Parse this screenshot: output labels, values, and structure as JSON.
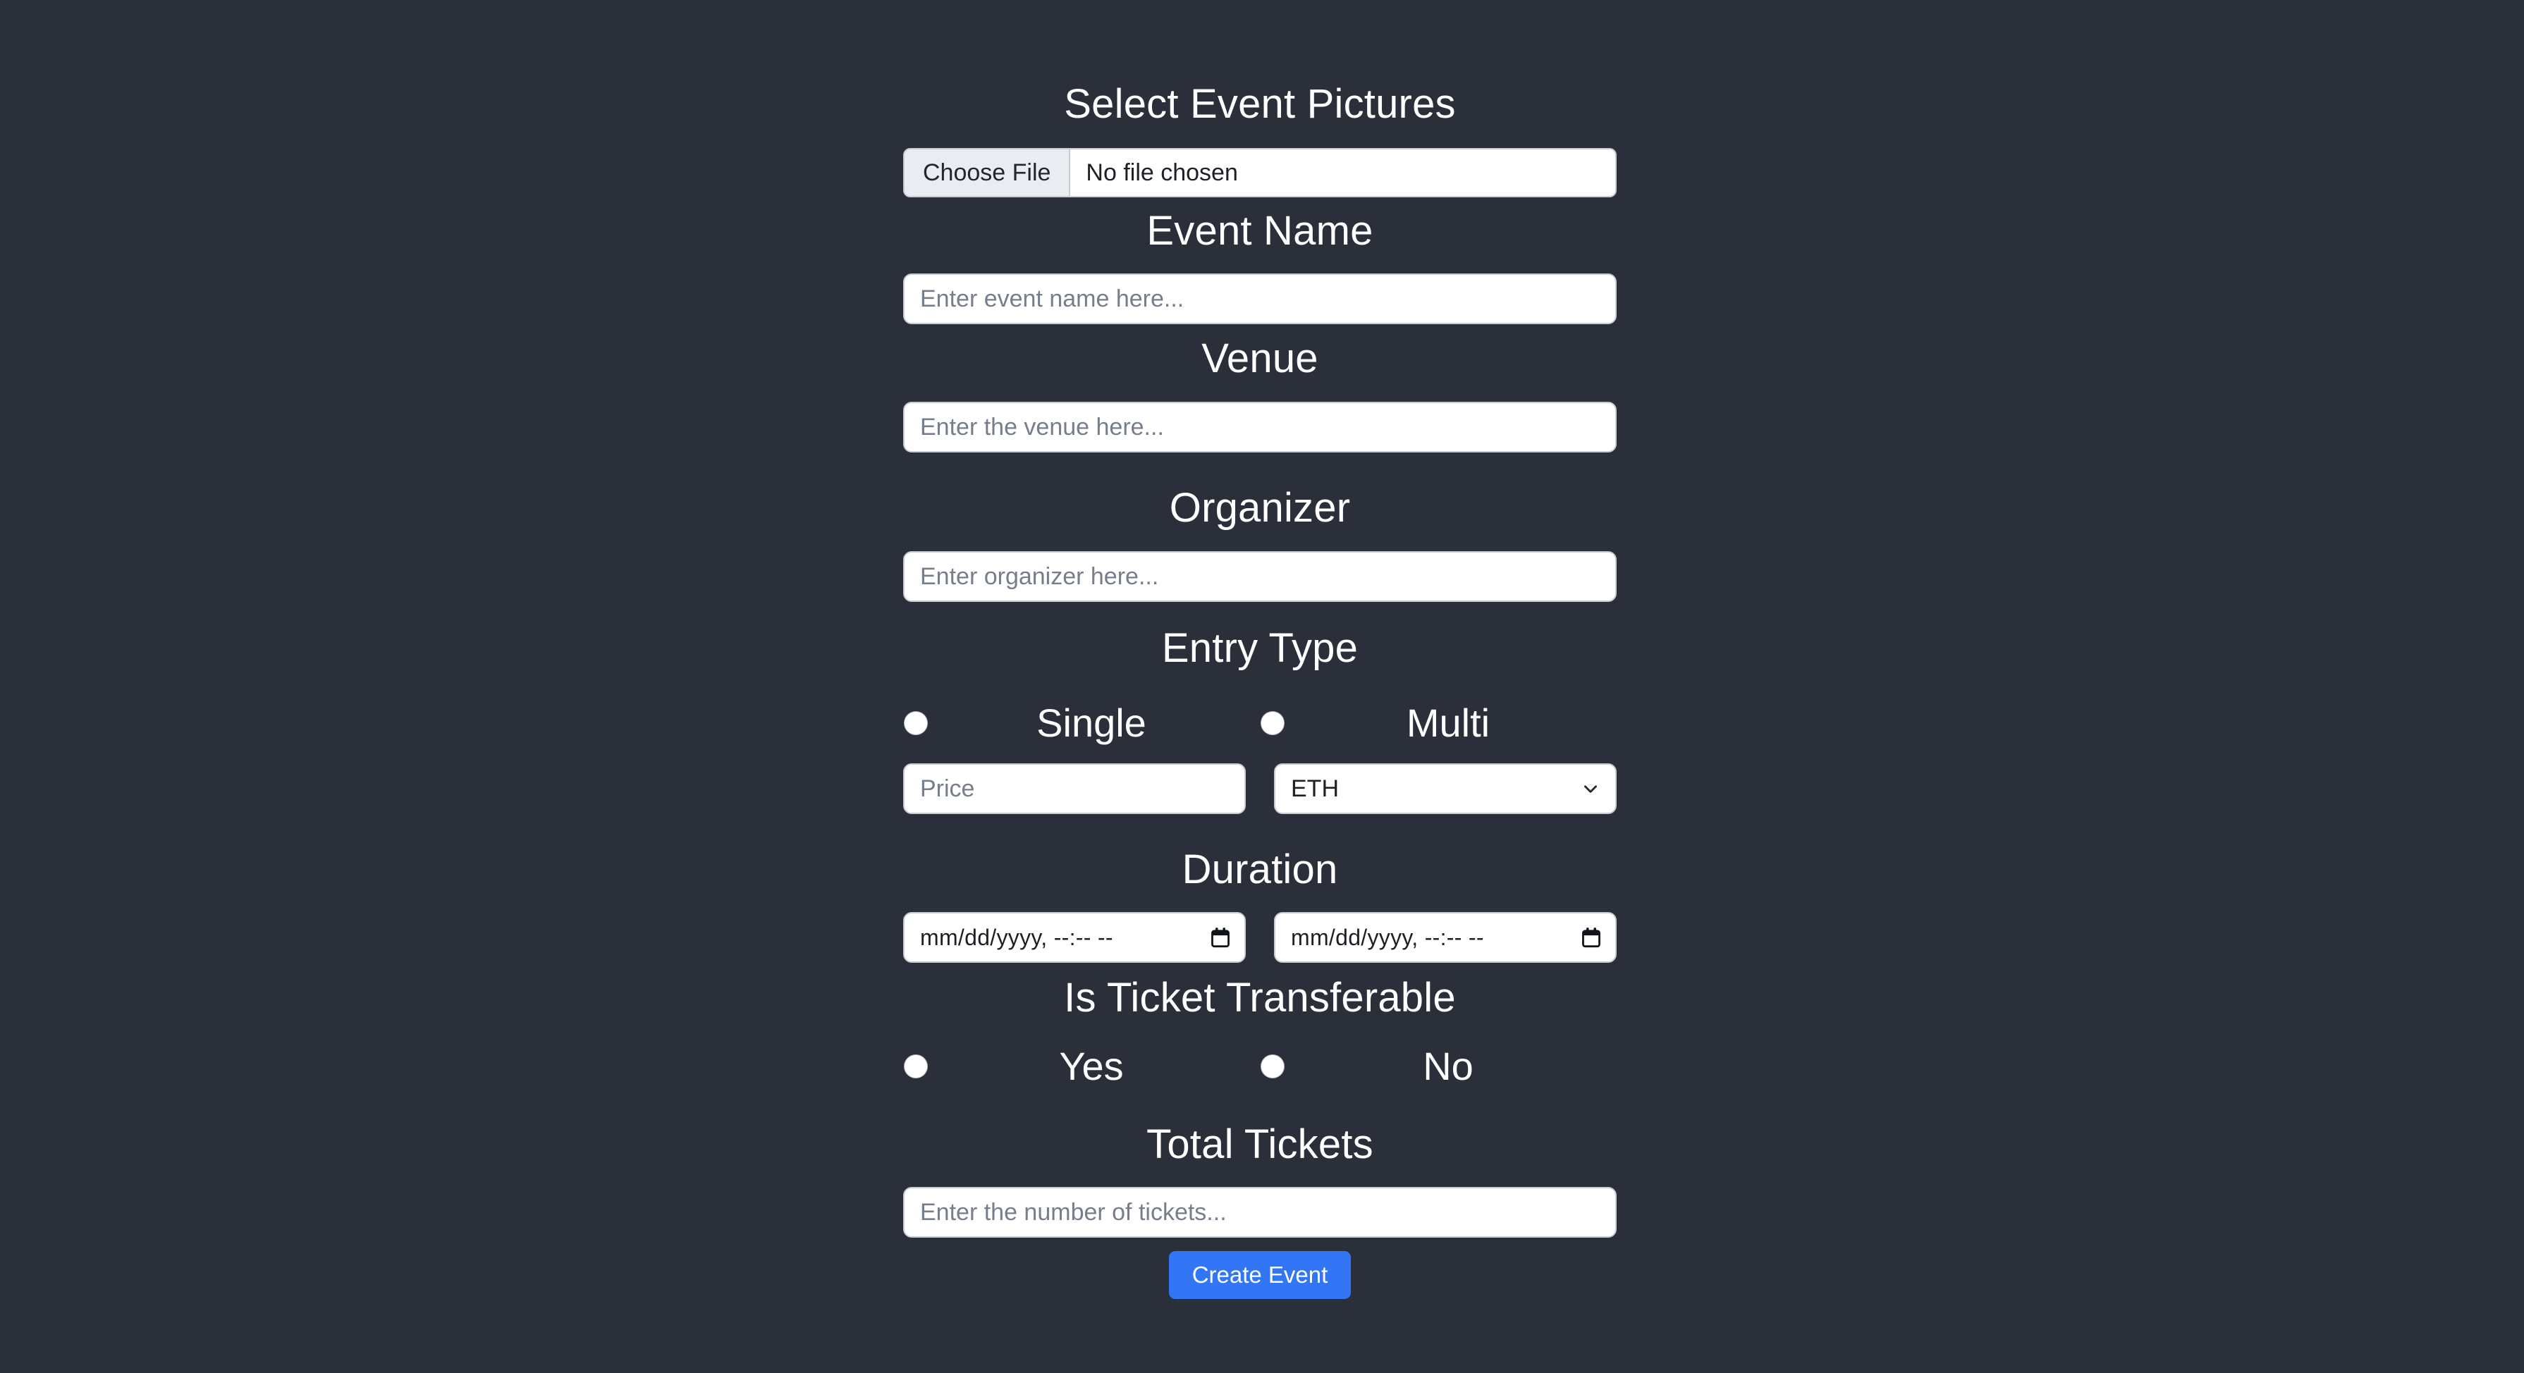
{
  "theme": {
    "background": "#2b2f3a",
    "accent": "#3275f5",
    "field_background": "#ffffff",
    "field_border": "#c7ccd4",
    "heading_color": "#ffffff",
    "placeholder_color": "#767e8c"
  },
  "form": {
    "picture": {
      "heading": "Select Event Pictures",
      "choose_button_label": "Choose File",
      "file_status": "No file chosen"
    },
    "event_name": {
      "heading": "Event Name",
      "placeholder": "Enter event name here...",
      "value": ""
    },
    "venue": {
      "heading": "Venue",
      "placeholder": "Enter the venue here...",
      "value": ""
    },
    "organizer": {
      "heading": "Organizer",
      "placeholder": "Enter organizer here...",
      "value": ""
    },
    "entry_type": {
      "heading": "Entry Type",
      "options": [
        {
          "label": "Single",
          "selected": false
        },
        {
          "label": "Multi",
          "selected": false
        }
      ]
    },
    "price": {
      "placeholder": "Price",
      "value": "",
      "currency_selected": "ETH",
      "currency_options": [
        "ETH"
      ]
    },
    "duration": {
      "heading": "Duration",
      "start": {
        "display": "mm/dd/yyyy, --:-- --",
        "value": ""
      },
      "end": {
        "display": "mm/dd/yyyy, --:-- --",
        "value": ""
      }
    },
    "transferable": {
      "heading": "Is Ticket Transferable",
      "options": [
        {
          "label": "Yes",
          "selected": false
        },
        {
          "label": "No",
          "selected": false
        }
      ]
    },
    "total_tickets": {
      "heading": "Total Tickets",
      "placeholder": "Enter the number of tickets...",
      "value": ""
    },
    "submit": {
      "label": "Create Event"
    }
  },
  "icons": {
    "chevron_down": "chevron-down-icon",
    "calendar": "calendar-icon"
  }
}
